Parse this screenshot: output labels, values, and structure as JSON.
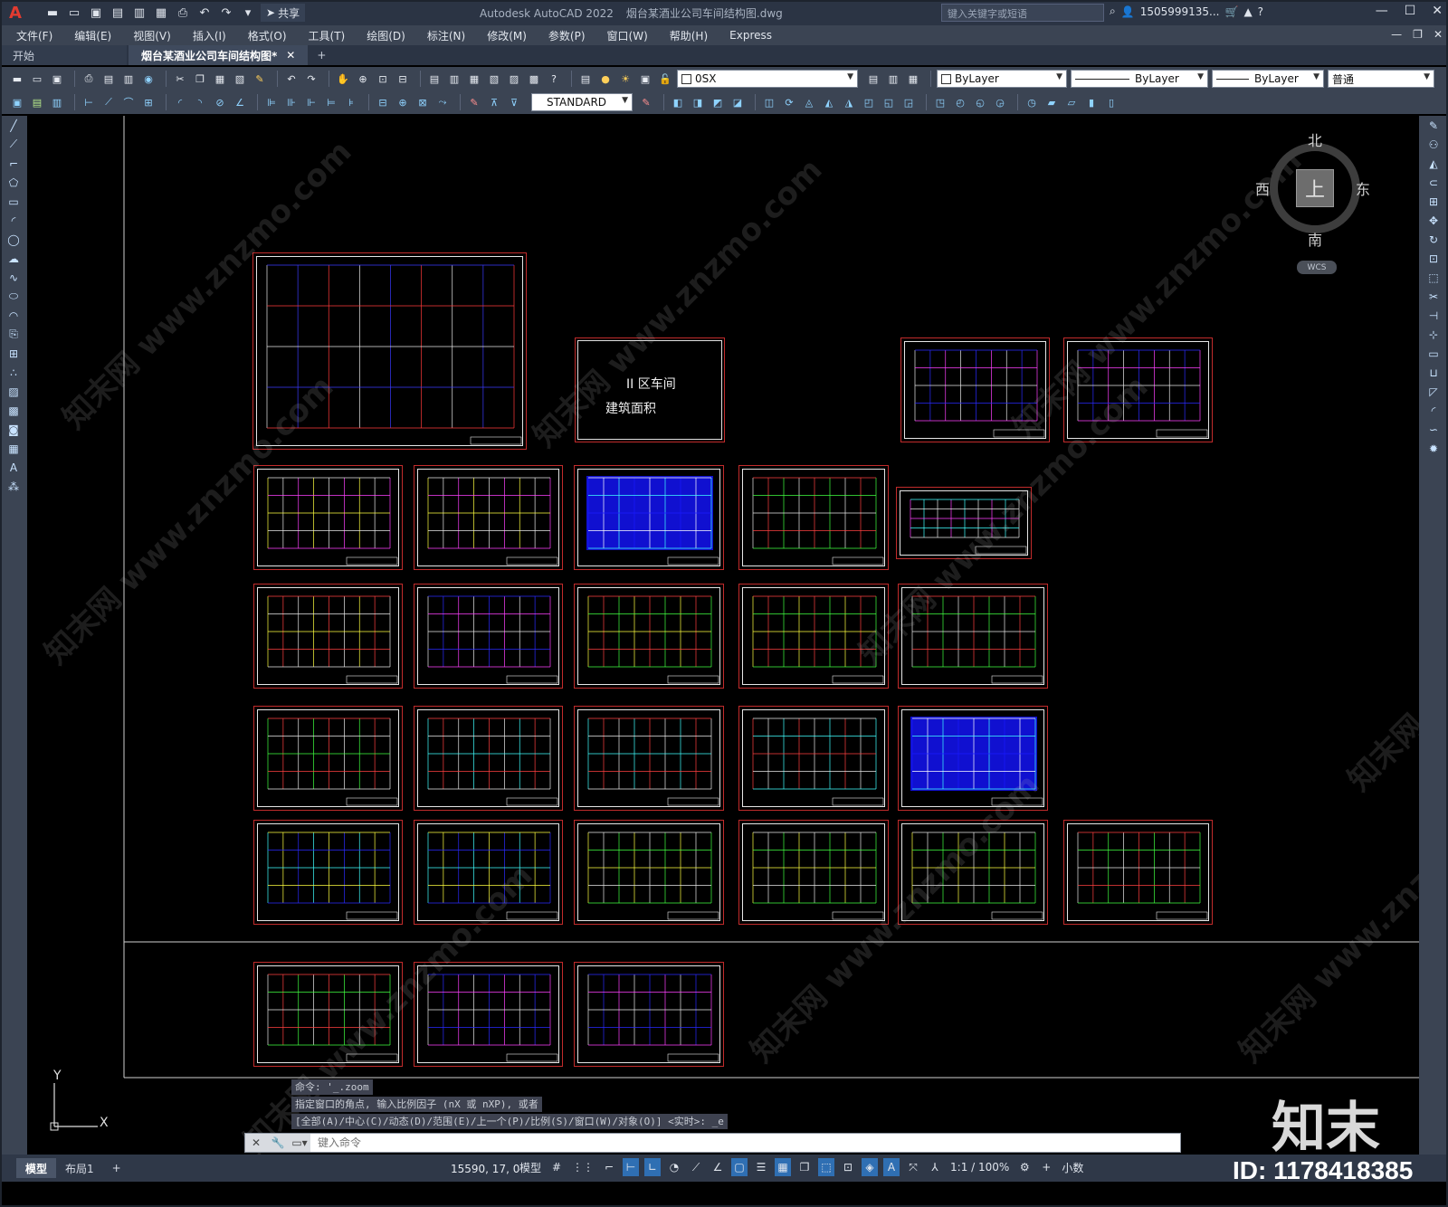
{
  "titlebar": {
    "app_name": "Autodesk AutoCAD 2022",
    "file_name": "烟台某酒业公司车间结构图.dwg",
    "share_label": "共享",
    "search_placeholder": "键入关键字或短语",
    "user": "1505999135..."
  },
  "menu": [
    "文件(F)",
    "编辑(E)",
    "视图(V)",
    "插入(I)",
    "格式(O)",
    "工具(T)",
    "绘图(D)",
    "标注(N)",
    "修改(M)",
    "参数(P)",
    "窗口(W)",
    "帮助(H)",
    "Express"
  ],
  "doc_tabs": {
    "start": "开始",
    "active": "烟台某酒业公司车间结构图*"
  },
  "toolbar": {
    "layer_name": "0SX",
    "color_combo": "ByLayer",
    "linetype_combo": "ByLayer",
    "lineweight_combo": "ByLayer",
    "plotstyle_combo": "普通",
    "text_style": "STANDARD"
  },
  "drawing": {
    "cover_sheet": {
      "line1": "II 区车间",
      "line2": "建筑面积"
    },
    "watermark": "知末网 www.znzmo.com"
  },
  "viewcube": {
    "north": "北",
    "south": "南",
    "east": "东",
    "west": "西",
    "top": "上",
    "wcs": "WCS"
  },
  "ucs": {
    "x_label": "X",
    "y_label": "Y"
  },
  "command": {
    "history": [
      "命令: '_.zoom",
      "指定窗口的角点, 输入比例因子 (nX 或 nXP), 或者",
      "[全部(A)/中心(C)/动态(D)/范围(E)/上一个(P)/比例(S)/窗口(W)/对象(O)] <实时>: _e"
    ],
    "input_placeholder": "键入命令"
  },
  "status": {
    "tab_model": "模型",
    "tab_layout": "布局1",
    "coords": "15590, 17, 0",
    "model_label": "模型",
    "scale": "1:1 / 100%",
    "units": "小数"
  },
  "badge": {
    "logo_text": "知末",
    "id_text": "ID: 1178418385"
  }
}
